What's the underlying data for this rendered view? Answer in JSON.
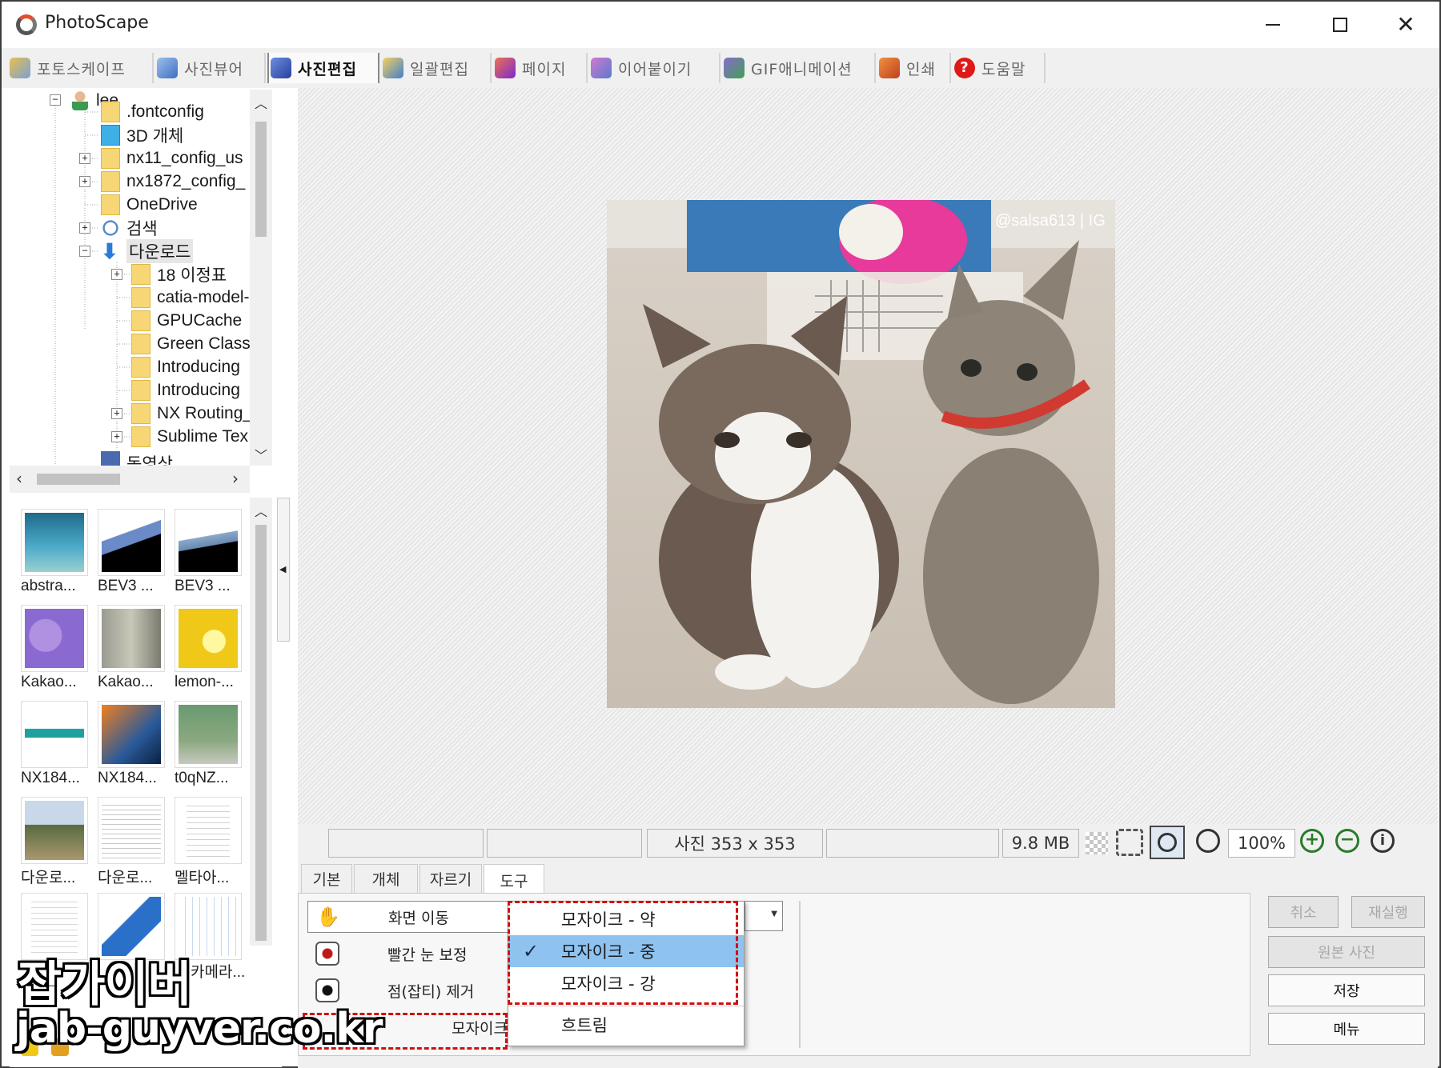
{
  "window": {
    "title": "PhotoScape"
  },
  "menu": [
    {
      "label": "포토스케이프",
      "color": "#c8a030"
    },
    {
      "label": "사진뷰어",
      "color": "#5a8ed6"
    },
    {
      "label": "사진편집",
      "color": "#3a5fc0"
    },
    {
      "label": "일괄편집",
      "color": "#e0a020"
    },
    {
      "label": "페이지",
      "color": "#d84a30"
    },
    {
      "label": "이어붙이기",
      "color": "#8a5ad0"
    },
    {
      "label": "GIF애니메이션",
      "color": "#6a4aa8"
    },
    {
      "label": "인쇄",
      "color": "#e07028"
    },
    {
      "label": "도움말",
      "color": "#e01818"
    }
  ],
  "active_menu": "사진편집",
  "tree": {
    "root": "lee",
    "items": [
      ".fontconfig",
      "3D 개체",
      "nx11_config_us",
      "nx1872_config_",
      "OneDrive",
      "검색",
      "다운로드"
    ],
    "downloads": [
      "18 이정표",
      "catia-model-",
      "GPUCache",
      "Green Classi",
      "Introducing",
      "Introducing",
      "NX Routing_",
      "Sublime Tex"
    ],
    "partial": "동영상"
  },
  "thumbnails": [
    "abstra...",
    "BEV3 ...",
    "BEV3 ...",
    "Kakao...",
    "Kakao...",
    "lemon-...",
    "NX184...",
    "NX184...",
    "t0qNZ...",
    "다운로...",
    "다운로...",
    "멜타아...",
    "",
    "",
    "카메라..."
  ],
  "photo": {
    "watermark": "@salsa613 | IG"
  },
  "status": {
    "size": "사진 353 x 353",
    "memory": "9.8 MB",
    "zoom": "100%"
  },
  "tabs": [
    "기본",
    "개체",
    "자르기",
    "도구"
  ],
  "active_tab": "도구",
  "tools": [
    "화면 이동",
    "빨간 눈 보정",
    "점(잡티) 제거",
    "모자이크"
  ],
  "dropdown": [
    "모자이크 - 약",
    "모자이크 - 중",
    "모자이크 - 강",
    "흐트림"
  ],
  "dropdown_selected": "모자이크 - 중",
  "actions": {
    "undo": "취소",
    "redo": "재실행",
    "original": "원본 사진",
    "save": "저장",
    "menu": "메뉴"
  },
  "watermark": {
    "line1": "잡가이버",
    "line2": "jab-guyver.co.kr"
  },
  "colors": {
    "highlight": "#8ec3f0",
    "marker": "#d01010",
    "canvas_bg": "#ededed"
  }
}
